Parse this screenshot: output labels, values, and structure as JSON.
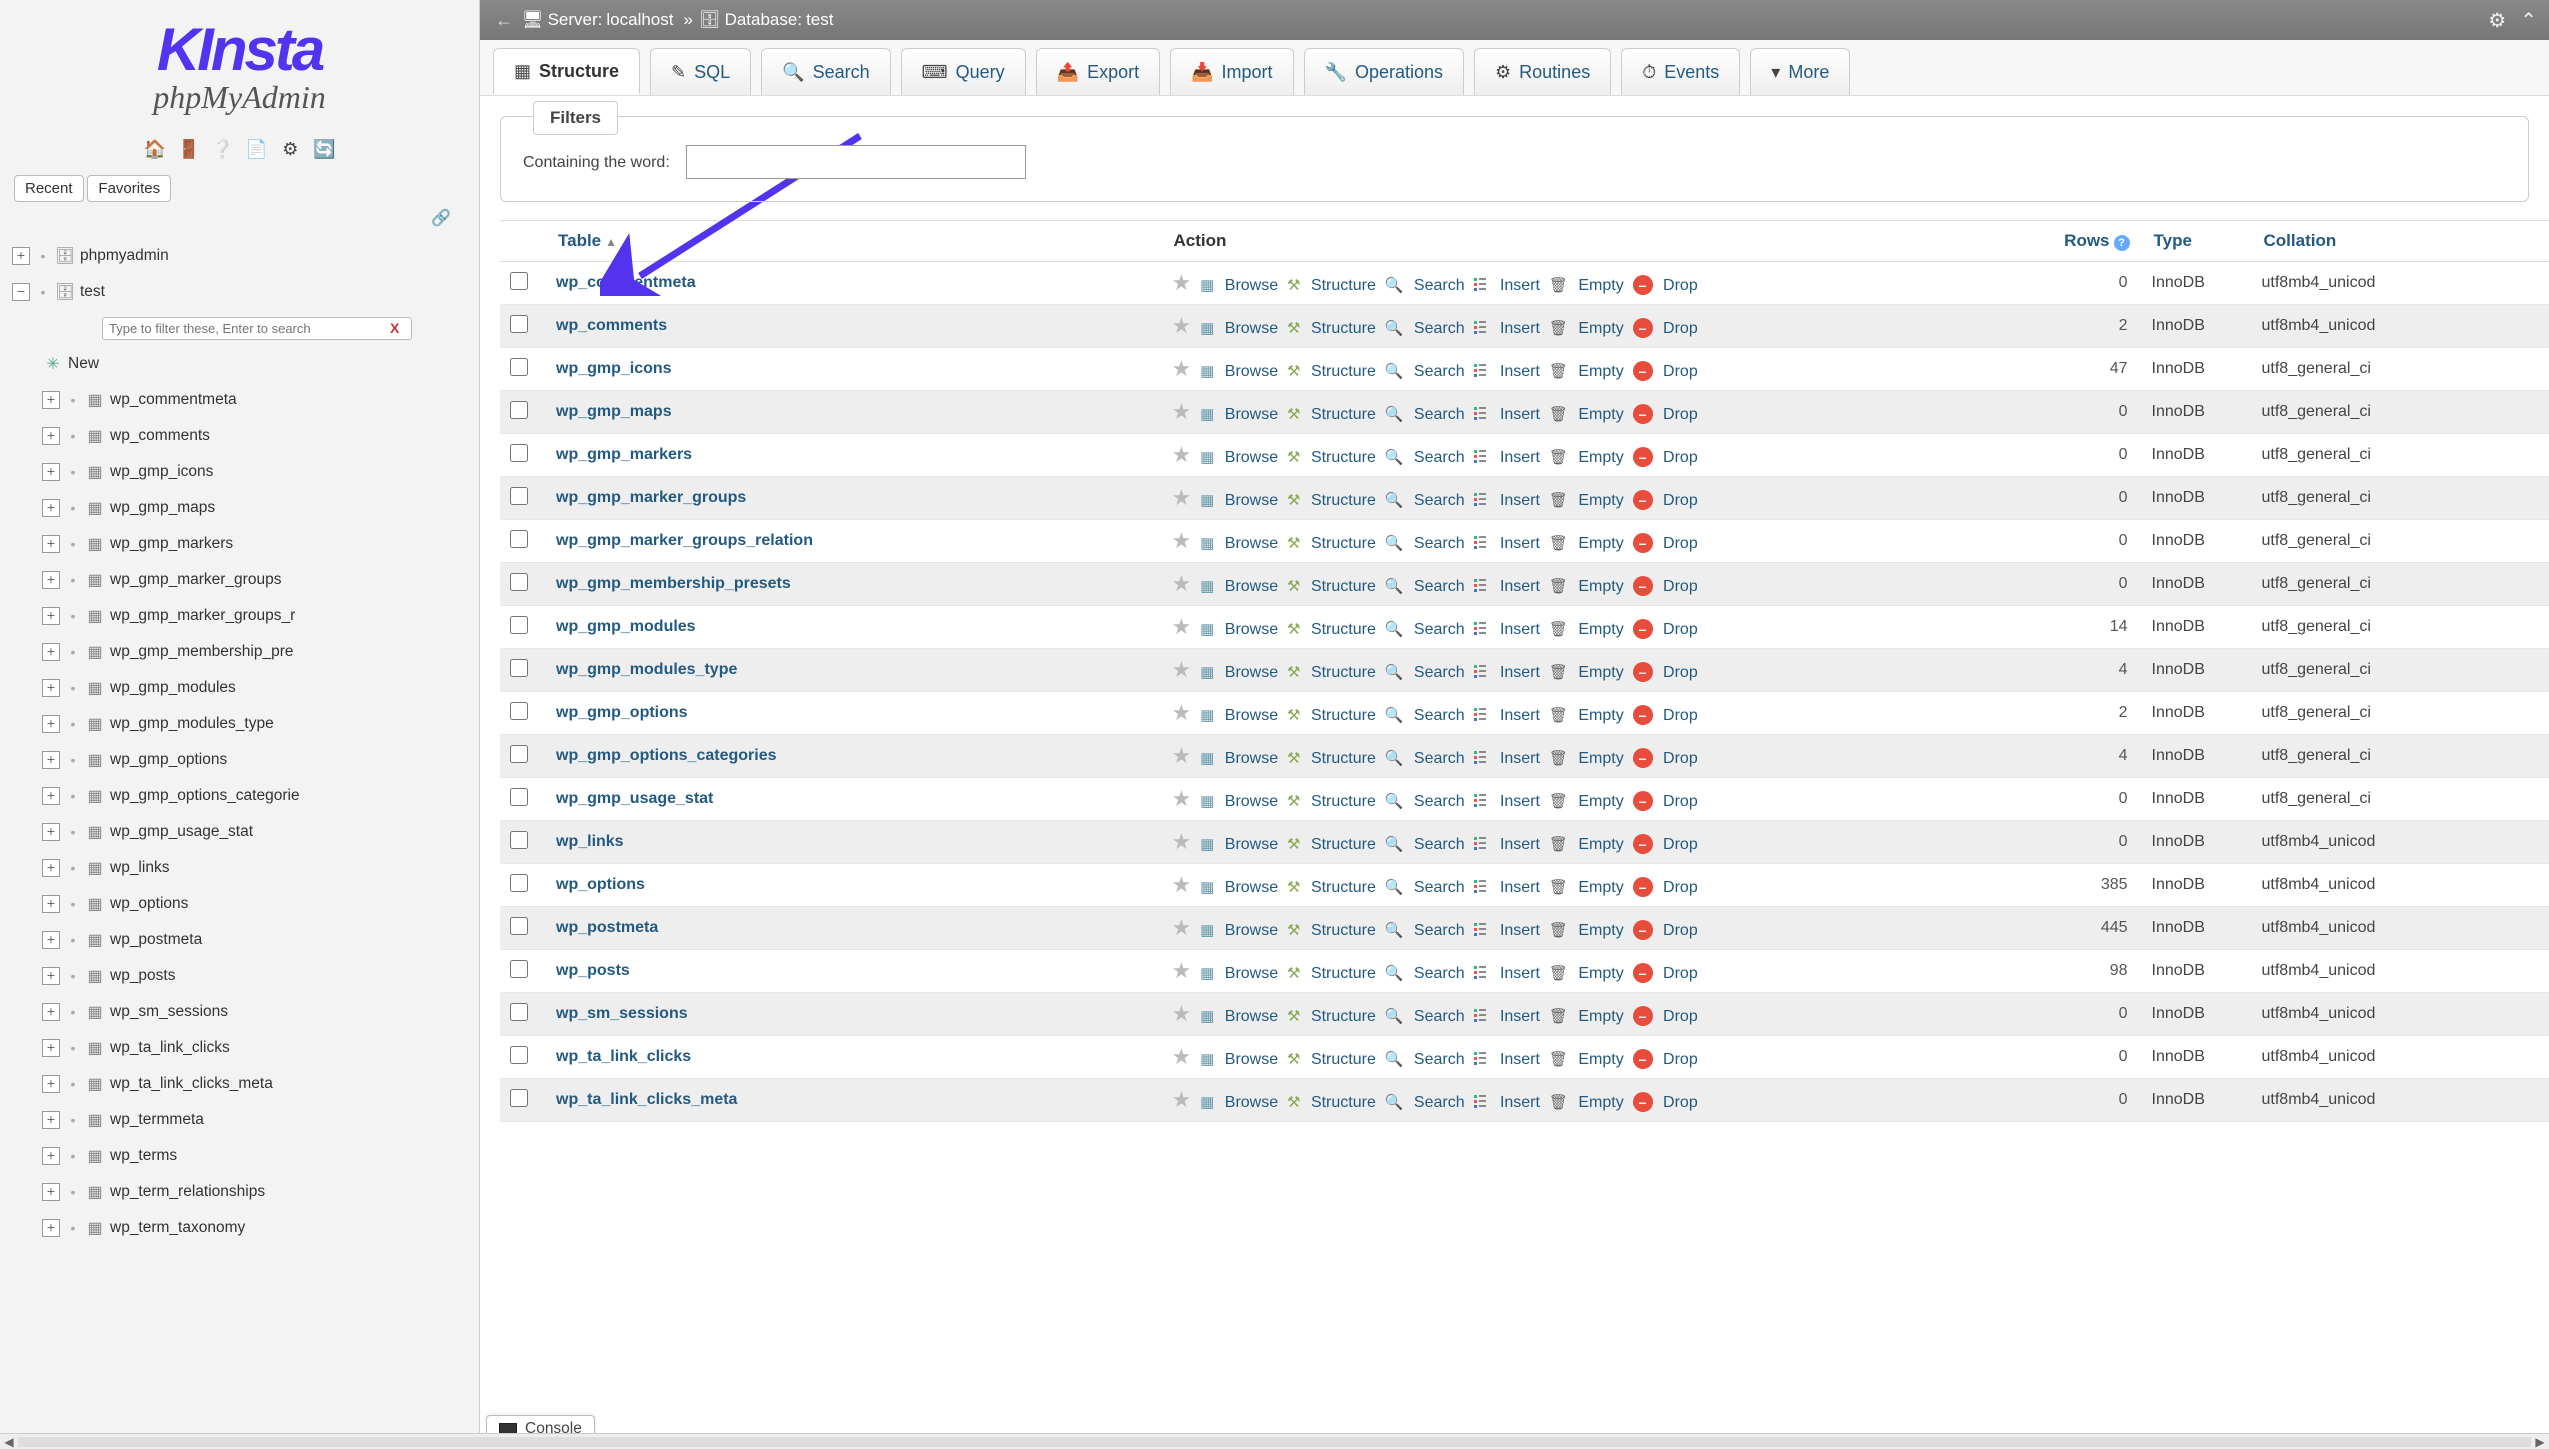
{
  "logo": {
    "brand": "KInsta",
    "product": "phpMyAdmin"
  },
  "sidebar": {
    "recent": "Recent",
    "favorites": "Favorites",
    "filter_placeholder": "Type to filter these, Enter to search",
    "root_nodes": [
      {
        "label": "phpmyadmin",
        "expanded": false
      },
      {
        "label": "test",
        "expanded": true
      }
    ],
    "new_label": "New",
    "tables": [
      "wp_commentmeta",
      "wp_comments",
      "wp_gmp_icons",
      "wp_gmp_maps",
      "wp_gmp_markers",
      "wp_gmp_marker_groups",
      "wp_gmp_marker_groups_r",
      "wp_gmp_membership_pre",
      "wp_gmp_modules",
      "wp_gmp_modules_type",
      "wp_gmp_options",
      "wp_gmp_options_categorie",
      "wp_gmp_usage_stat",
      "wp_links",
      "wp_options",
      "wp_postmeta",
      "wp_posts",
      "wp_sm_sessions",
      "wp_ta_link_clicks",
      "wp_ta_link_clicks_meta",
      "wp_termmeta",
      "wp_terms",
      "wp_term_relationships",
      "wp_term_taxonomy"
    ]
  },
  "breadcrumb": {
    "server_label": "Server:",
    "server_name": "localhost",
    "db_label": "Database:",
    "db_name": "test"
  },
  "tabs": [
    {
      "icon": "▦",
      "label": "Structure",
      "active": true
    },
    {
      "icon": "✎",
      "label": "SQL"
    },
    {
      "icon": "🔍",
      "label": "Search"
    },
    {
      "icon": "⌨",
      "label": "Query"
    },
    {
      "icon": "📤",
      "label": "Export"
    },
    {
      "icon": "📥",
      "label": "Import"
    },
    {
      "icon": "🔧",
      "label": "Operations"
    },
    {
      "icon": "⚙",
      "label": "Routines"
    },
    {
      "icon": "⏱",
      "label": "Events"
    },
    {
      "icon": "▾",
      "label": "More"
    }
  ],
  "filters": {
    "legend": "Filters",
    "label": "Containing the word:"
  },
  "table_header": {
    "table": "Table",
    "action": "Action",
    "rows": "Rows",
    "type": "Type",
    "collation": "Collation"
  },
  "actions": {
    "browse": "Browse",
    "structure": "Structure",
    "search": "Search",
    "insert": "Insert",
    "empty": "Empty",
    "drop": "Drop"
  },
  "rows": [
    {
      "name": "wp_commentmeta",
      "rows": 0,
      "type": "InnoDB",
      "collation": "utf8mb4_unicod"
    },
    {
      "name": "wp_comments",
      "rows": 2,
      "type": "InnoDB",
      "collation": "utf8mb4_unicod"
    },
    {
      "name": "wp_gmp_icons",
      "rows": 47,
      "type": "InnoDB",
      "collation": "utf8_general_ci"
    },
    {
      "name": "wp_gmp_maps",
      "rows": 0,
      "type": "InnoDB",
      "collation": "utf8_general_ci"
    },
    {
      "name": "wp_gmp_markers",
      "rows": 0,
      "type": "InnoDB",
      "collation": "utf8_general_ci"
    },
    {
      "name": "wp_gmp_marker_groups",
      "rows": 0,
      "type": "InnoDB",
      "collation": "utf8_general_ci"
    },
    {
      "name": "wp_gmp_marker_groups_relation",
      "rows": 0,
      "type": "InnoDB",
      "collation": "utf8_general_ci"
    },
    {
      "name": "wp_gmp_membership_presets",
      "rows": 0,
      "type": "InnoDB",
      "collation": "utf8_general_ci"
    },
    {
      "name": "wp_gmp_modules",
      "rows": 14,
      "type": "InnoDB",
      "collation": "utf8_general_ci"
    },
    {
      "name": "wp_gmp_modules_type",
      "rows": 4,
      "type": "InnoDB",
      "collation": "utf8_general_ci"
    },
    {
      "name": "wp_gmp_options",
      "rows": 2,
      "type": "InnoDB",
      "collation": "utf8_general_ci"
    },
    {
      "name": "wp_gmp_options_categories",
      "rows": 4,
      "type": "InnoDB",
      "collation": "utf8_general_ci"
    },
    {
      "name": "wp_gmp_usage_stat",
      "rows": 0,
      "type": "InnoDB",
      "collation": "utf8_general_ci"
    },
    {
      "name": "wp_links",
      "rows": 0,
      "type": "InnoDB",
      "collation": "utf8mb4_unicod"
    },
    {
      "name": "wp_options",
      "rows": 385,
      "type": "InnoDB",
      "collation": "utf8mb4_unicod"
    },
    {
      "name": "wp_postmeta",
      "rows": 445,
      "type": "InnoDB",
      "collation": "utf8mb4_unicod"
    },
    {
      "name": "wp_posts",
      "rows": 98,
      "type": "InnoDB",
      "collation": "utf8mb4_unicod"
    },
    {
      "name": "wp_sm_sessions",
      "rows": 0,
      "type": "InnoDB",
      "collation": "utf8mb4_unicod"
    },
    {
      "name": "wp_ta_link_clicks",
      "rows": 0,
      "type": "InnoDB",
      "collation": "utf8mb4_unicod"
    },
    {
      "name": "wp_ta_link_clicks_meta",
      "rows": 0,
      "type": "InnoDB",
      "collation": "utf8mb4_unicod"
    }
  ],
  "console": "Console"
}
